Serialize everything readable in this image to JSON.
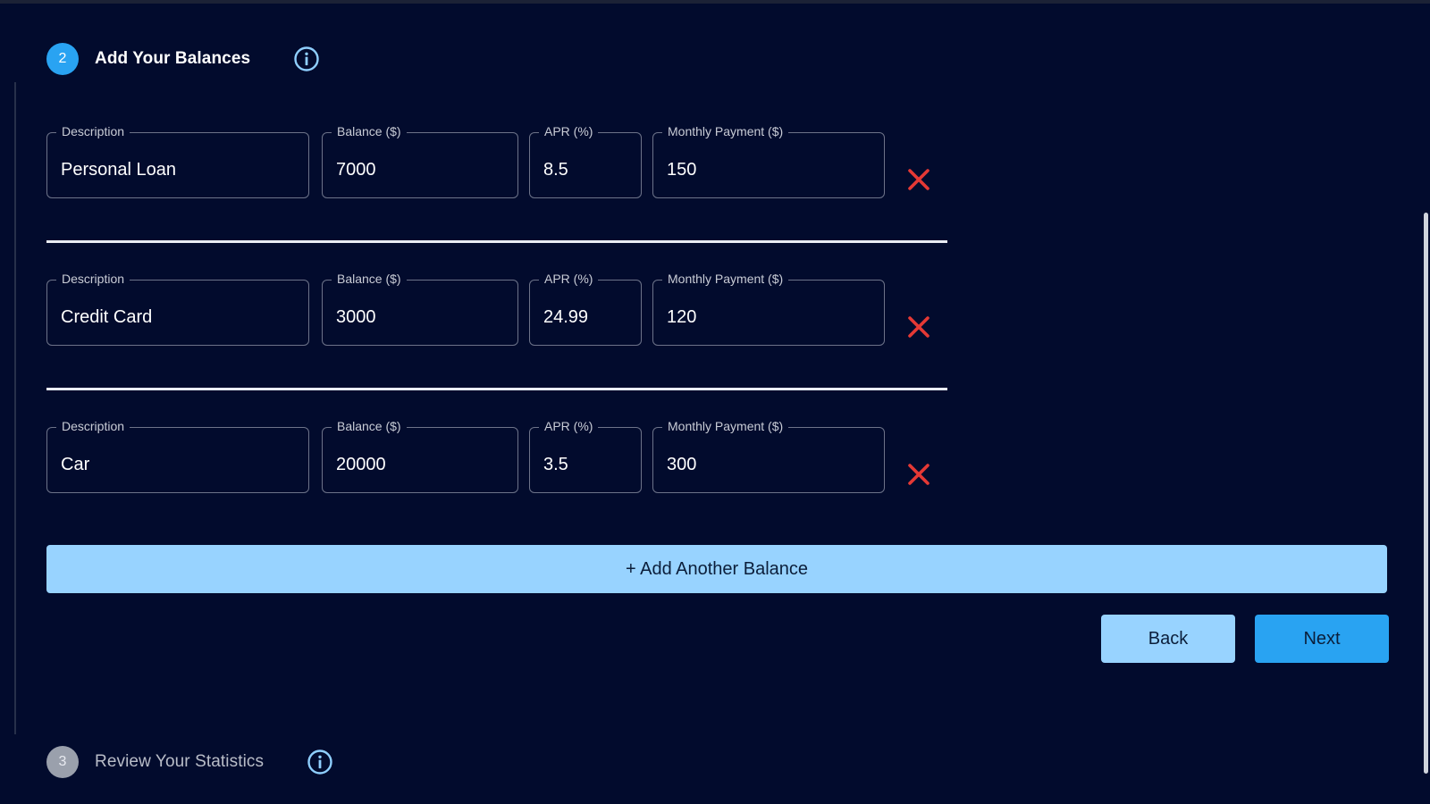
{
  "steps": {
    "current": {
      "number": "2",
      "title": "Add Your Balances"
    },
    "next": {
      "number": "3",
      "title": "Review Your Statistics"
    }
  },
  "labels": {
    "description": "Description",
    "balance": "Balance ($)",
    "apr": "APR (%)",
    "payment": "Monthly Payment ($)"
  },
  "balances": [
    {
      "description": "Personal Loan",
      "balance": "7000",
      "apr": "8.5",
      "payment": "150"
    },
    {
      "description": "Credit Card",
      "balance": "3000",
      "apr": "24.99",
      "payment": "120"
    },
    {
      "description": "Car",
      "balance": "20000",
      "apr": "3.5",
      "payment": "300"
    }
  ],
  "actions": {
    "add_label": "+ Add Another Balance",
    "back_label": "Back",
    "next_label": "Next"
  },
  "icons": {
    "info": "info-icon",
    "remove": "close-icon"
  },
  "colors": {
    "background": "#020b2d",
    "accent": "#29a3f2",
    "light_accent": "#98d3ff",
    "remove": "#e53935"
  }
}
